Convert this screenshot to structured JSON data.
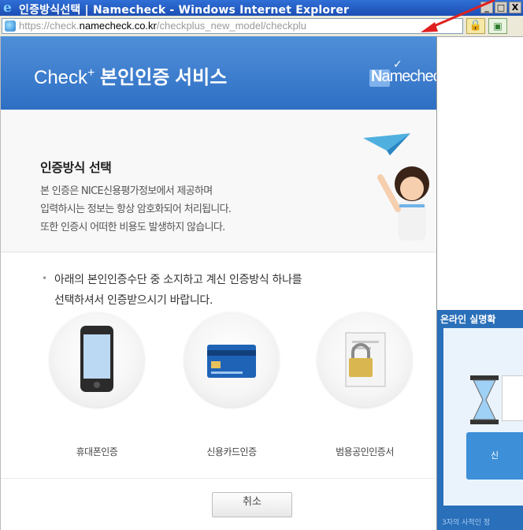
{
  "window": {
    "title": "인증방식선택 | Namecheck - Windows Internet Explorer",
    "buttons": {
      "minimize": "_",
      "maximize": "□",
      "close": "X"
    }
  },
  "addressbar": {
    "url_scheme": "https://",
    "url_sub": "check.",
    "url_host": "namecheck.co.kr",
    "url_path": "/checkplus_new_model/checkplu"
  },
  "header": {
    "title_prefix": "Check",
    "title_plus": "+",
    "title_main": " 본인인증 서비스",
    "brand_n": "N",
    "brand_rest": "amecheck"
  },
  "intro": {
    "title": "인증방식 선택",
    "lines": [
      "본 인증은 NICE신용평가정보에서 제공하며",
      "입력하시는 정보는 항상 암호화되어 처리됩니다.",
      "또한 인증시 어떠한 비용도 발생하지 않습니다."
    ]
  },
  "notice": {
    "lines": [
      "아래의 본인인증수단 중 소지하고 계신 인증방식 하나를",
      "선택하셔서 인증받으시기 바랍니다."
    ]
  },
  "methods": [
    {
      "label": "휴대폰인증",
      "icon": "mobile-phone-icon"
    },
    {
      "label": "신용카드인증",
      "icon": "credit-card-icon"
    },
    {
      "label": "범용공인인증서",
      "icon": "certificate-icon"
    }
  ],
  "cancel_label": "취소",
  "background_window": {
    "title": "온라인 실명확",
    "button_text": "신",
    "footer": "3자의 사적인 정"
  },
  "colors": {
    "header_blue": "#3a7ccc",
    "title_bar": "#2459c4",
    "annotation_red": "#e02020"
  }
}
